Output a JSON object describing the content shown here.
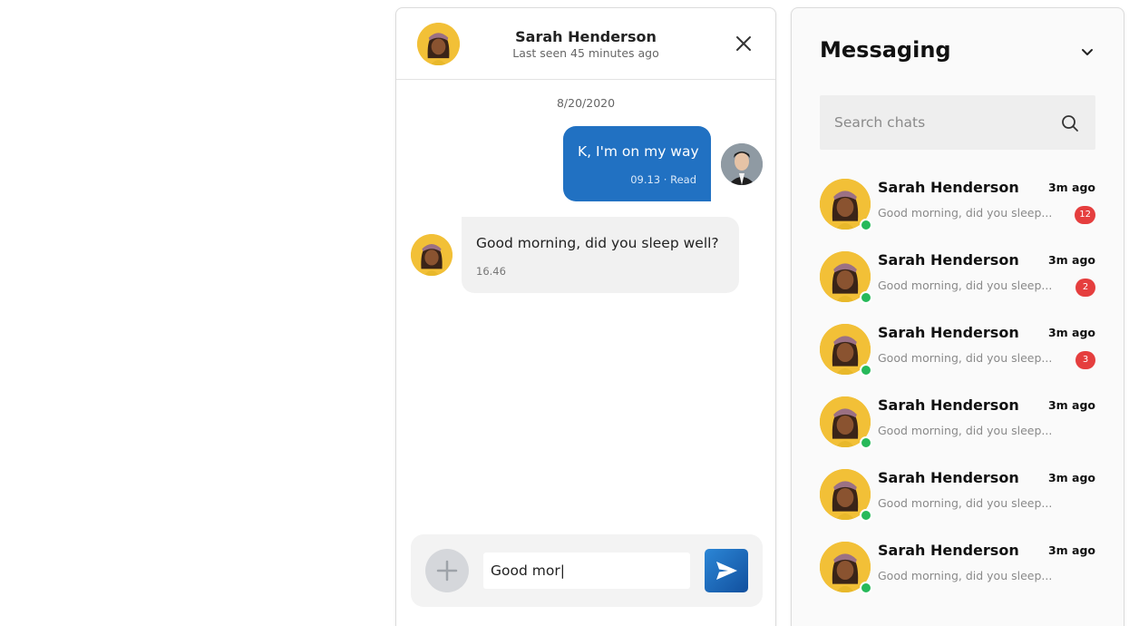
{
  "chat_window": {
    "contact_name": "Sarah Henderson",
    "last_seen": "Last seen 45 minutes ago",
    "date_separator": "8/20/2020",
    "messages": [
      {
        "direction": "outgoing",
        "text": "K, I'm on my way",
        "meta": "09.13 · Read"
      },
      {
        "direction": "incoming",
        "text": "Good morning, did you sleep well?",
        "meta": "16.46"
      }
    ],
    "composer": {
      "input_value": "Good mor|"
    }
  },
  "messaging_panel": {
    "title": "Messaging",
    "search": {
      "placeholder": "Search chats"
    },
    "conversations": [
      {
        "name": "Sarah Henderson",
        "time": "3m ago",
        "preview": "Good morning, did you sleep...",
        "unread": "12"
      },
      {
        "name": "Sarah Henderson",
        "time": "3m ago",
        "preview": "Good morning, did you sleep...",
        "unread": "2"
      },
      {
        "name": "Sarah Henderson",
        "time": "3m ago",
        "preview": "Good morning, did you sleep...",
        "unread": "3"
      },
      {
        "name": "Sarah Henderson",
        "time": "3m ago",
        "preview": "Good morning, did you sleep...",
        "unread": ""
      },
      {
        "name": "Sarah Henderson",
        "time": "3m ago",
        "preview": "Good morning, did you sleep...",
        "unread": ""
      },
      {
        "name": "Sarah Henderson",
        "time": "3m ago",
        "preview": "Good morning, did you sleep...",
        "unread": ""
      }
    ]
  },
  "colors": {
    "accent": "#2171c2",
    "badge": "#e53e3e",
    "online": "#27b95a",
    "avatar_bg": "#f2c037"
  },
  "icons": [
    "close-icon",
    "plus-icon",
    "send-icon",
    "search-icon",
    "chevron-down-icon"
  ]
}
